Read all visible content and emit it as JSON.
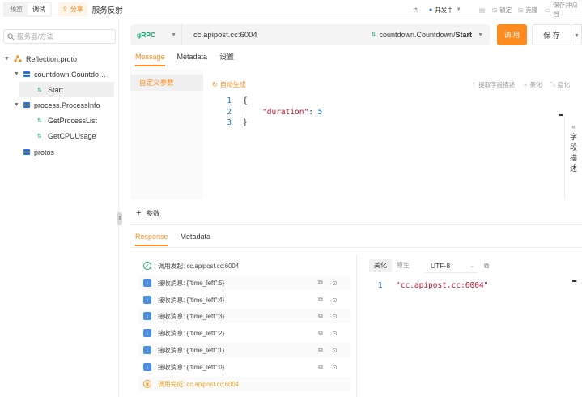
{
  "topbar": {
    "modes": [
      "预览",
      "调试"
    ],
    "active_mode": "调试",
    "share_label": "分享",
    "page_title": "服务反射",
    "env_label": "开发中",
    "lock_label": "锁定",
    "clone_label": "克隆",
    "save_run_label": "保存并归档"
  },
  "sidebar": {
    "search_placeholder": "服务器/方法",
    "tree": [
      {
        "label": "Reflection.proto",
        "type": "proto",
        "expanded": true
      },
      {
        "label": "countdown.Countdo…",
        "type": "service",
        "expanded": true
      },
      {
        "label": "Start",
        "type": "method",
        "selected": true
      },
      {
        "label": "process.ProcessInfo",
        "type": "service",
        "expanded": true
      },
      {
        "label": "GetProcessList",
        "type": "method"
      },
      {
        "label": "GetCPUUsage",
        "type": "method"
      },
      {
        "label": "protos",
        "type": "service"
      }
    ]
  },
  "request": {
    "protocol": "gRPC",
    "url": "cc.apipost.cc:6004",
    "method_prefix": "countdown.Countdown/",
    "method_name": "Start",
    "call_label": "调 用",
    "save_label": "保 存"
  },
  "req_tabs": {
    "items": [
      "Message",
      "Metadata",
      "设置"
    ],
    "active": "Message"
  },
  "message": {
    "custom_param_label": "自定义参数",
    "auto_generate_label": "自动生成",
    "extract_desc_label": "提取字段描述",
    "beautify_label": "美化",
    "collapse_label": "隐化",
    "line_numbers": [
      "1",
      "2",
      "3"
    ],
    "code": {
      "open": "{",
      "key": "\"duration\"",
      "colon": ": ",
      "value": "5",
      "close": "}"
    },
    "field_desc_chars": [
      "字",
      "段",
      "描",
      "述"
    ],
    "add_param_label": "参数"
  },
  "res_tabs": {
    "items": [
      "Response",
      "Metadata"
    ],
    "active": "Response"
  },
  "response": {
    "rows": [
      {
        "kind": "start",
        "text": "调用发起: cc.apipost.cc:6004"
      },
      {
        "kind": "msg",
        "text": "接收消息: {\"time_left\":5}"
      },
      {
        "kind": "msg",
        "text": "接收消息: {\"time_left\":4}"
      },
      {
        "kind": "msg",
        "text": "接收消息: {\"time_left\":3}"
      },
      {
        "kind": "msg",
        "text": "接收消息: {\"time_left\":2}"
      },
      {
        "kind": "msg",
        "text": "接收消息: {\"time_left\":1}"
      },
      {
        "kind": "msg",
        "text": "接收消息: {\"time_left\":0}"
      },
      {
        "kind": "end",
        "text": "调用完成: cc.apipost.cc:6004"
      }
    ],
    "view_modes": [
      "美化",
      "原生"
    ],
    "active_view": "美化",
    "encoding": "UTF-8",
    "line_number": "1",
    "body": "\"cc.apipost.cc:6004\""
  },
  "colors": {
    "accent": "#ff8a1f",
    "grpc": "#16a06b",
    "info_blue": "#4a90e2"
  }
}
